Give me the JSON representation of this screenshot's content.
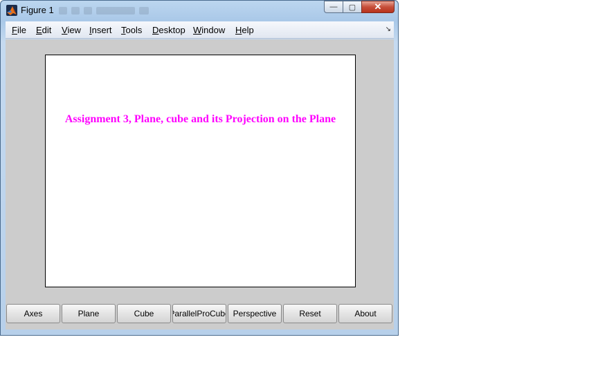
{
  "window": {
    "title": "Figure 1",
    "close_glyph": "✕",
    "min_glyph": "—",
    "max_glyph": "▢"
  },
  "menubar": {
    "items": [
      "File",
      "Edit",
      "View",
      "Insert",
      "Tools",
      "Desktop",
      "Window",
      "Help"
    ],
    "dock_glyph": "↘"
  },
  "axes": {
    "title": "Assignment 3, Plane, cube and its Projection on the Plane",
    "title_color": "#ff00ff",
    "background": "#ffffff"
  },
  "buttons": [
    "Axes",
    "Plane",
    "Cube",
    "ParallelProCube",
    "Perspective",
    "Reset",
    "About"
  ],
  "colors": {
    "figure_background": "#cccccc",
    "frame_accent": "#b7d0ea"
  }
}
